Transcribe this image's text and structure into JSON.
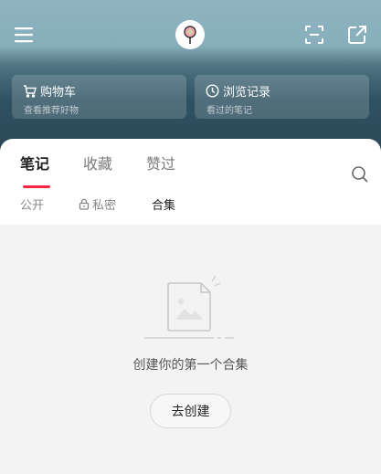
{
  "header": {
    "menu_icon": "hamburger-menu-icon",
    "logo_icon": "app-logo-icon",
    "scan_icon": "scan-icon",
    "share_icon": "share-icon"
  },
  "quick_cards": [
    {
      "title": "购物车",
      "subtitle": "查看推荐好物",
      "icon": "cart-icon"
    },
    {
      "title": "浏览记录",
      "subtitle": "看过的笔记",
      "icon": "history-clock-icon"
    }
  ],
  "tabs": [
    {
      "label": "笔记",
      "active": true
    },
    {
      "label": "收藏",
      "active": false
    },
    {
      "label": "赞过",
      "active": false
    }
  ],
  "subtabs": [
    {
      "label": "公开",
      "active": false
    },
    {
      "label": "私密",
      "active": false,
      "icon": "lock-icon"
    },
    {
      "label": "合集",
      "active": true
    }
  ],
  "empty_state": {
    "message": "创建你的第一个合集",
    "button_label": "去创建",
    "illustration": "empty-document-icon"
  },
  "colors": {
    "accent": "#ff2442",
    "header_top": "#8fb4c1",
    "header_bottom": "#2a4655"
  }
}
